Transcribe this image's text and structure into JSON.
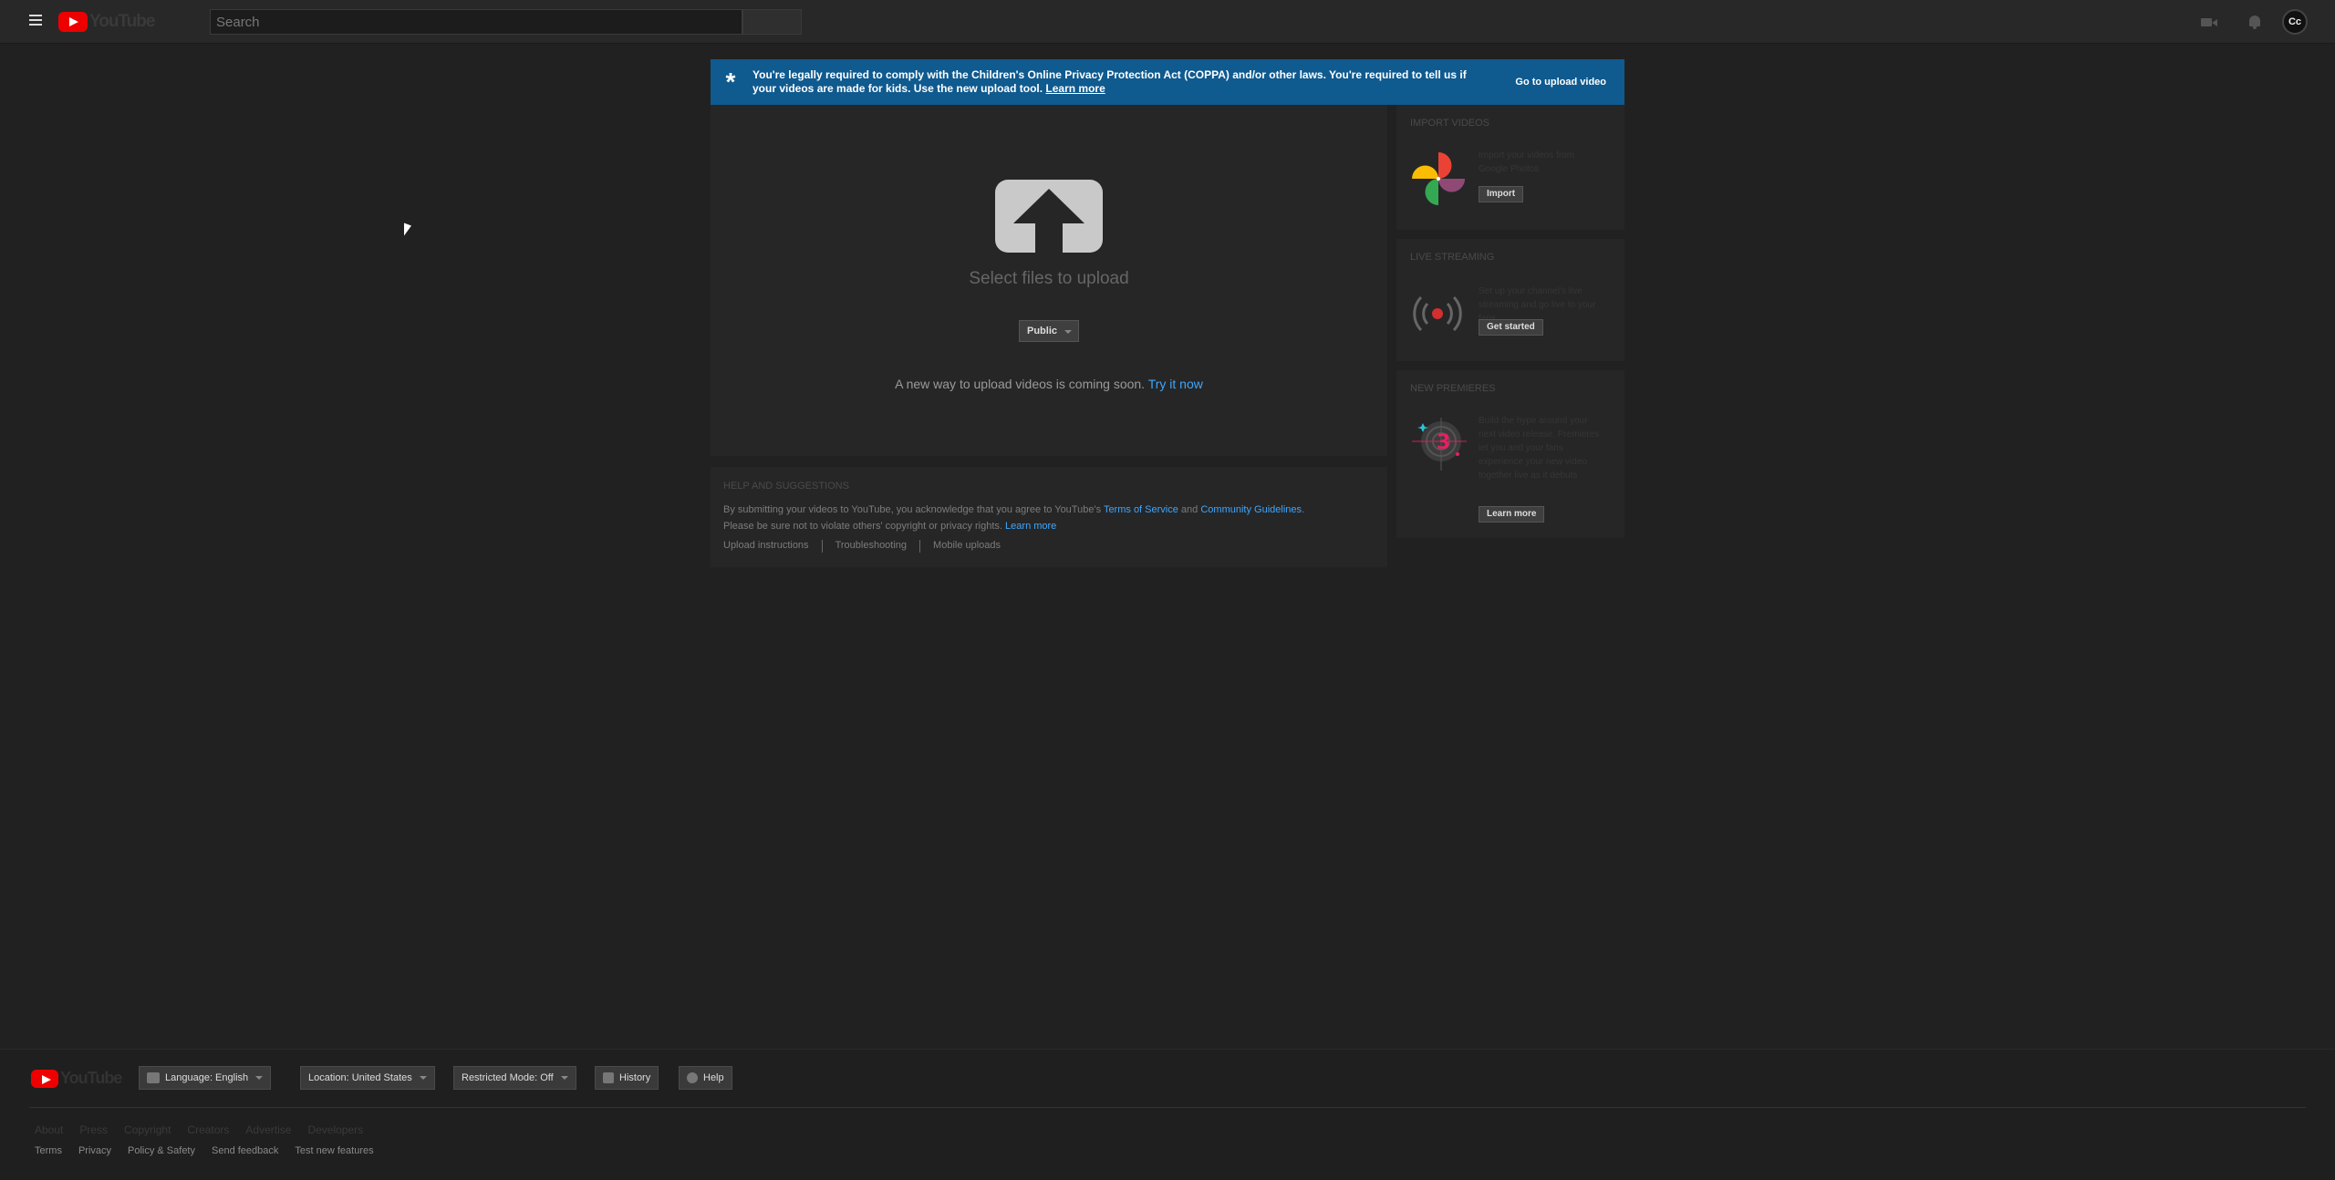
{
  "header": {
    "logo_text": "YouTube",
    "search_placeholder": "Search",
    "avatar_initials": "Cc"
  },
  "banner": {
    "text": "You're legally required to comply with the Children's Online Privacy Protection Act (COPPA) and/or other laws. You're required to tell us if your videos are made for kids. Use the new upload tool.",
    "learn_more": "Learn more",
    "button": "Go to upload video"
  },
  "upload": {
    "select_files": "Select files to upload",
    "privacy": "Public",
    "new_way": "A new way to upload videos is coming soon.",
    "try_it": "Try it now"
  },
  "help": {
    "title": "HELP AND SUGGESTIONS",
    "text_1": "By submitting your videos to YouTube, you acknowledge that you agree to YouTube's",
    "terms_link": "Terms of Service",
    "and": "and",
    "guidelines_link": "Community Guidelines",
    "text_2": "Please be sure not to violate others' copyright or privacy rights.",
    "learn_more": "Learn more",
    "links": [
      "Upload instructions",
      "Troubleshooting",
      "Mobile uploads"
    ]
  },
  "cards": {
    "import": {
      "title": "IMPORT VIDEOS",
      "desc": "Import your videos from Google Photos",
      "button": "Import"
    },
    "live": {
      "title": "LIVE STREAMING",
      "desc": "Set up your channel's live streaming and go live to your fans",
      "button": "Get started"
    },
    "premieres": {
      "title": "NEW PREMIERES",
      "desc": "Build the hype around your next video release. Premieres let you and your fans experience your new video together live as it debuts",
      "button": "Learn more"
    }
  },
  "footer": {
    "logo_text": "YouTube",
    "language": "Language: English",
    "location": "Location: United States",
    "restricted": "Restricted Mode: Off",
    "history": "History",
    "help": "Help",
    "links_1": [
      "About",
      "Press",
      "Copyright",
      "Creators",
      "Advertise",
      "Developers"
    ],
    "links_2": [
      "Terms",
      "Privacy",
      "Policy & Safety",
      "Send feedback",
      "Test new features"
    ]
  },
  "colors": {
    "banner": "#0f5a8f",
    "link": "#3ea6ff",
    "brand_red": "#ee0000"
  }
}
